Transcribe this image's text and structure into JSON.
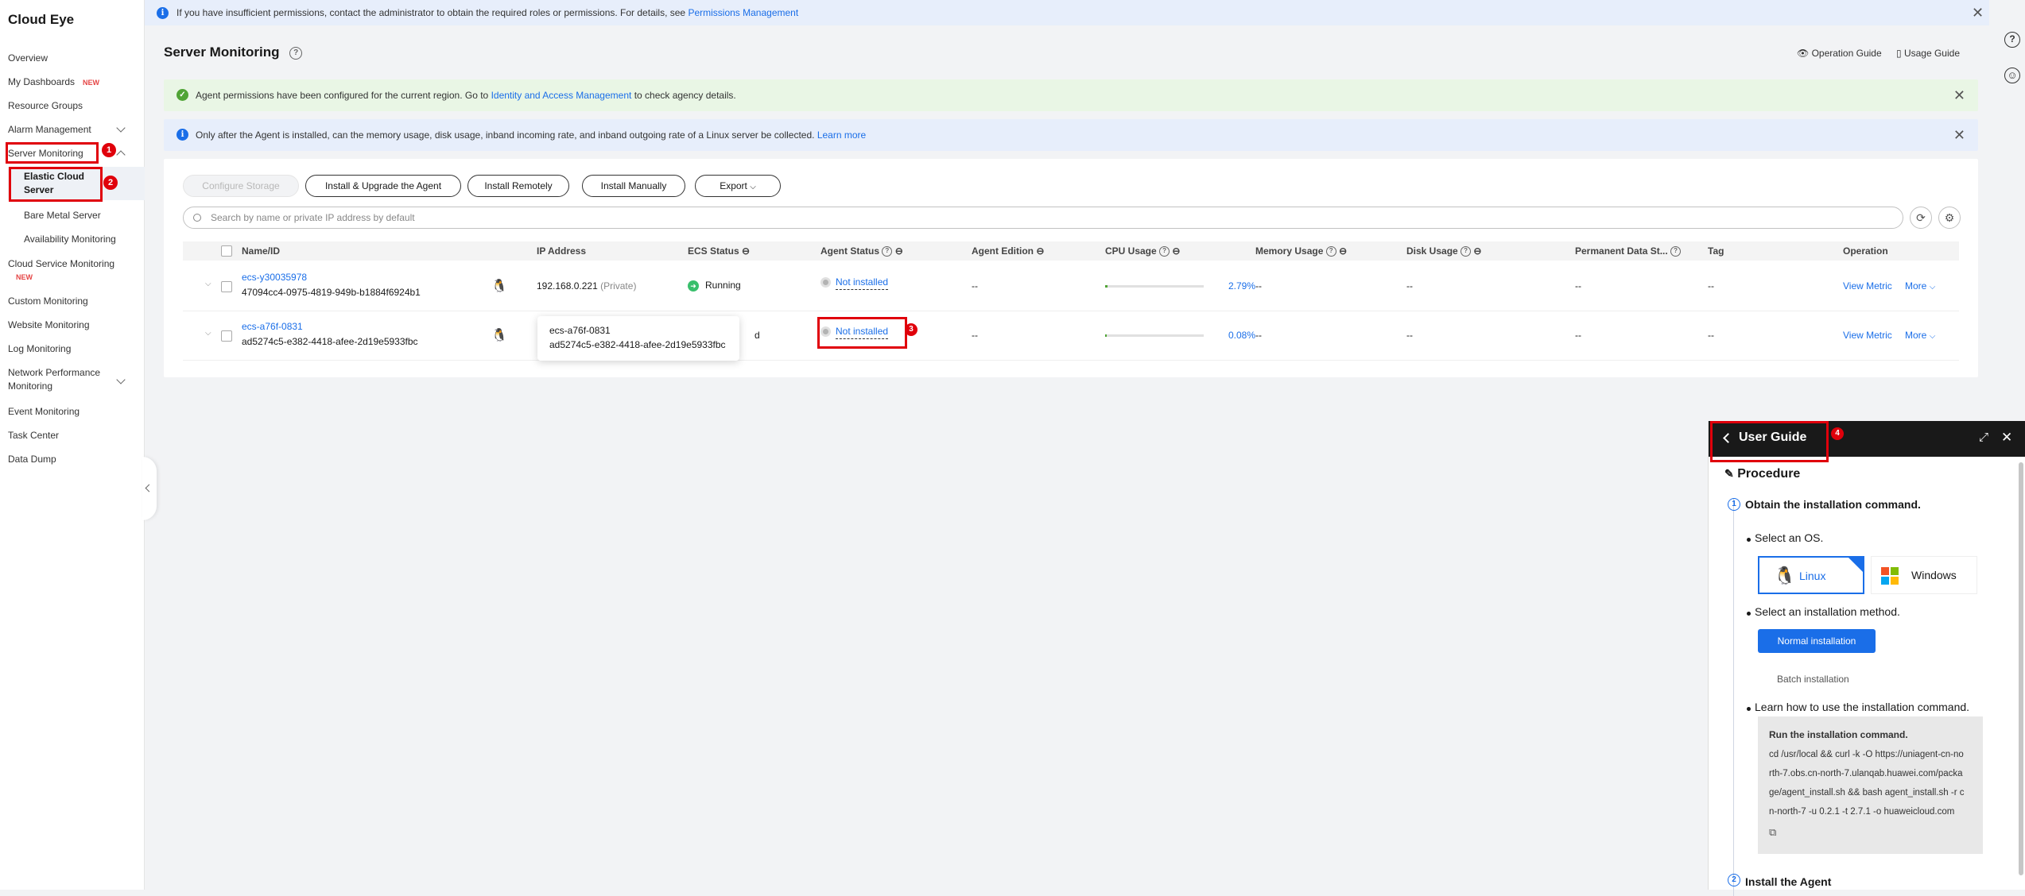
{
  "app": {
    "title": "Cloud Eye"
  },
  "sidebar": {
    "new_badge": "NEW",
    "items": [
      {
        "label": "Overview"
      },
      {
        "label": "My Dashboards"
      },
      {
        "label": "Resource Groups"
      },
      {
        "label": "Alarm Management"
      },
      {
        "label": "Server Monitoring"
      },
      {
        "label": "Elastic Cloud"
      },
      {
        "label": "Server"
      },
      {
        "label": "Bare Metal Server"
      },
      {
        "label": "Availability Monitoring"
      },
      {
        "label": "Cloud Service Monitoring"
      },
      {
        "label": "Custom Monitoring"
      },
      {
        "label": "Website Monitoring"
      },
      {
        "label": "Log Monitoring"
      },
      {
        "label": "Network Performance"
      },
      {
        "label": "Monitoring"
      },
      {
        "label": "Event Monitoring"
      },
      {
        "label": "Task Center"
      },
      {
        "label": "Data Dump"
      }
    ]
  },
  "annotations": [
    "1",
    "2",
    "3",
    "4"
  ],
  "topbar": {
    "text": "If you have insufficient permissions, contact the administrator to obtain the required roles or permissions. For details, see",
    "link": "Permissions Management"
  },
  "page": {
    "title": "Server Monitoring",
    "operation_guide": "Operation Guide",
    "usage_guide": "Usage Guide"
  },
  "notices": {
    "green_pre": "Agent permissions have been configured for the current region. Go to",
    "green_link": "Identity and Access Management",
    "green_post": "to check agency details.",
    "blue_text": "Only after the Agent is installed, can the memory usage, disk usage, inband incoming rate, and inband outgoing rate of a Linux server be collected.",
    "blue_link": "Learn more"
  },
  "toolbar": {
    "configure_storage": "Configure Storage",
    "install_upgrade": "Install & Upgrade the Agent",
    "install_remotely": "Install Remotely",
    "install_manually": "Install Manually",
    "export": "Export"
  },
  "search": {
    "placeholder": "Search by name or private IP address by default"
  },
  "table": {
    "headers": {
      "name": "Name/ID",
      "ip": "IP Address",
      "ecs_status": "ECS Status",
      "agent_status": "Agent Status",
      "agent_edition": "Agent Edition",
      "cpu": "CPU Usage",
      "memory": "Memory Usage",
      "disk": "Disk Usage",
      "permanent": "Permanent Data St...",
      "tag": "Tag",
      "operation": "Operation"
    },
    "rows": [
      {
        "name": "ecs-y30035978",
        "id": "47094cc4-0975-4819-949b-b1884f6924b1",
        "ip": "192.168.0.221",
        "ip_type": "(Private)",
        "ecs_status": "Running",
        "agent_status": "Not installed",
        "agent_edition": "--",
        "cpu": "2.79%",
        "cpu_fraction": 0.0279,
        "memory": "--",
        "disk": "--",
        "permanent": "--",
        "tag": "--",
        "view_metric": "View Metric",
        "more": "More"
      },
      {
        "name": "ecs-a76f-0831",
        "id": "ad5274c5-e382-4418-afee-2d19e5933fbc",
        "ecs_status_partial": "d",
        "agent_status": "Not installed",
        "agent_edition": "--",
        "cpu": "0.08%",
        "cpu_fraction": 0.0008,
        "memory": "--",
        "disk": "--",
        "permanent": "--",
        "tag": "--",
        "view_metric": "View Metric",
        "more": "More"
      }
    ]
  },
  "tooltip": {
    "line1": "ecs-a76f-0831",
    "line2": "ad5274c5-e382-4418-afee-2d19e5933fbc"
  },
  "guide": {
    "title": "User Guide",
    "procedure": "Procedure",
    "step1": "Obtain the installation command.",
    "select_os": "Select an OS.",
    "linux": "Linux",
    "windows": "Windows",
    "select_method": "Select an installation method.",
    "normal_install": "Normal installation",
    "batch_install": "Batch installation",
    "learn_cmd": "Learn how to use the installation command.",
    "run_cmd_title": "Run the installation command.",
    "cmd_lines": [
      "cd /usr/local && curl -k -O https://uniagent-cn-no",
      "rth-7.obs.cn-north-7.ulanqab.huawei.com/packa",
      "ge/agent_install.sh && bash agent_install.sh -r c",
      "n-north-7 -u 0.2.1 -t 2.7.1 -o huaweicloud.com"
    ],
    "step2": "Install the Agent"
  }
}
